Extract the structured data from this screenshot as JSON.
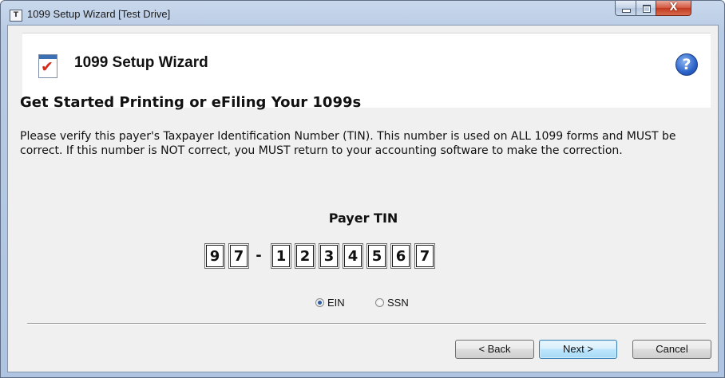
{
  "window": {
    "title": "1099 Setup Wizard [Test Drive]",
    "app_icon_letter": "T",
    "icon": "app-icon",
    "close_glyph": "X"
  },
  "header": {
    "title": "1099 Setup Wizard",
    "icon": "checklist-icon",
    "help_glyph": "?"
  },
  "content": {
    "heading": "Get Started Printing or eFiling Your 1099s",
    "instructions": "Please verify this payer's Taxpayer Identification Number (TIN). This number is used on ALL 1099 forms and MUST be correct. If this number is NOT correct, you MUST return to your accounting software to make the correction.",
    "tin_label": "Payer TIN",
    "tin": {
      "digits": [
        "9",
        "7",
        "1",
        "2",
        "3",
        "4",
        "5",
        "6",
        "7"
      ],
      "separator": "-"
    },
    "tin_type": {
      "options": [
        "EIN",
        "SSN"
      ],
      "selected": "EIN"
    }
  },
  "footer": {
    "back_label": "< Back",
    "next_label": "Next >",
    "cancel_label": "Cancel"
  },
  "colors": {
    "accent": "#3c7fb1",
    "close_button": "#c23a20",
    "check_mark": "#d62a1a"
  }
}
